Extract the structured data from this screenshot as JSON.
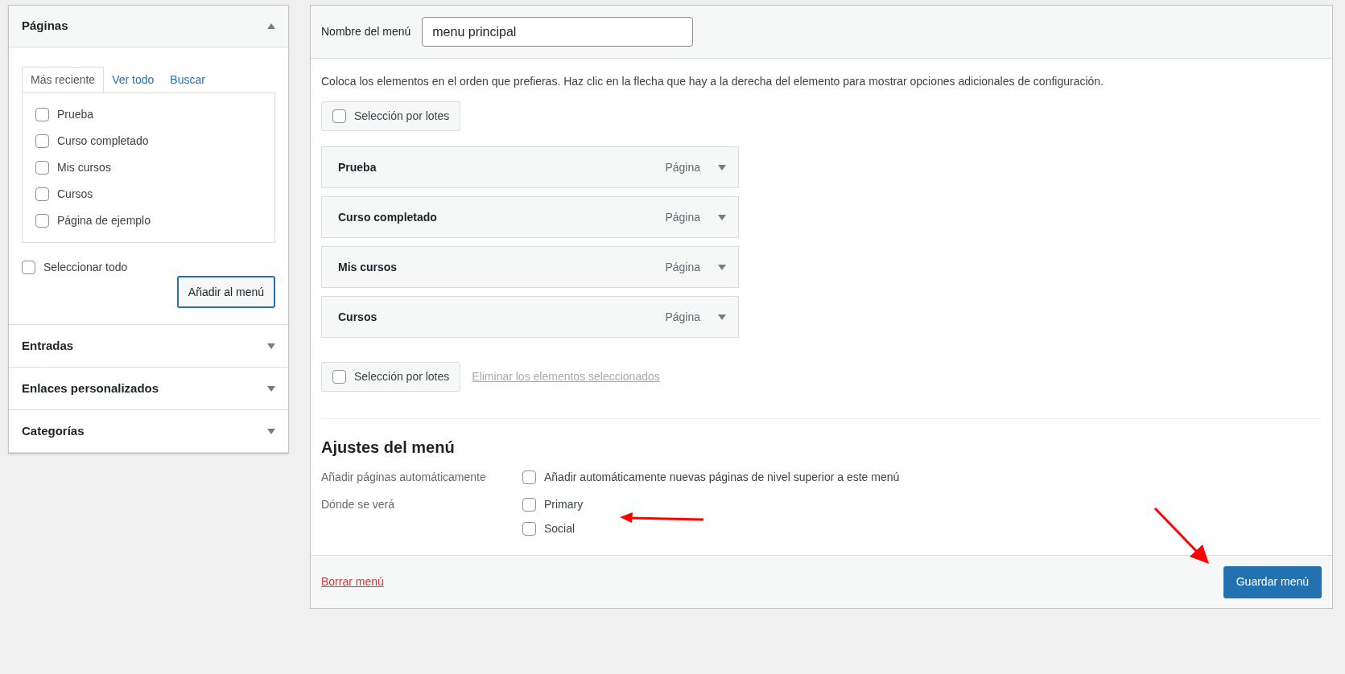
{
  "sidebar": {
    "sections": [
      {
        "title": "Páginas",
        "expanded": true,
        "tabs": [
          {
            "label": "Más reciente",
            "selected": true
          },
          {
            "label": "Ver todo",
            "selected": false
          },
          {
            "label": "Buscar",
            "selected": false
          }
        ],
        "items": [
          {
            "label": "Prueba",
            "checked": false
          },
          {
            "label": "Curso completado",
            "checked": false
          },
          {
            "label": "Mis cursos",
            "checked": false
          },
          {
            "label": "Cursos",
            "checked": false
          },
          {
            "label": "Página de ejemplo",
            "checked": false
          }
        ],
        "select_all": {
          "label": "Seleccionar todo",
          "checked": false
        },
        "add_button": "Añadir al menú"
      },
      {
        "title": "Entradas",
        "expanded": false
      },
      {
        "title": "Enlaces personalizados",
        "expanded": false
      },
      {
        "title": "Categorías",
        "expanded": false
      }
    ]
  },
  "editor": {
    "name_label": "Nombre del menú",
    "name_value": "menu principal",
    "instructions": "Coloca los elementos en el orden que prefieras. Haz clic en la flecha que hay a la derecha del elemento para mostrar opciones adicionales de configuración.",
    "bulk_top": {
      "label": "Selección por lotes",
      "checked": false
    },
    "menu_items": [
      {
        "title": "Prueba",
        "type": "Página"
      },
      {
        "title": "Curso completado",
        "type": "Página"
      },
      {
        "title": "Mis cursos",
        "type": "Página"
      },
      {
        "title": "Cursos",
        "type": "Página"
      }
    ],
    "bulk_bottom": {
      "label": "Selección por lotes",
      "checked": false
    },
    "remove_link": "Eliminar los elementos seleccionados",
    "settings": {
      "heading": "Ajustes del menú",
      "auto_add": {
        "label": "Añadir páginas automáticamente",
        "option": {
          "label": "Añadir automáticamente nuevas páginas de nivel superior a este menú",
          "checked": false
        }
      },
      "locations": {
        "label": "Dónde se verá",
        "options": [
          {
            "label": "Primary",
            "checked": false
          },
          {
            "label": "Social",
            "checked": false
          }
        ]
      }
    },
    "delete_link": "Borrar menú",
    "save_button": "Guardar menú"
  }
}
